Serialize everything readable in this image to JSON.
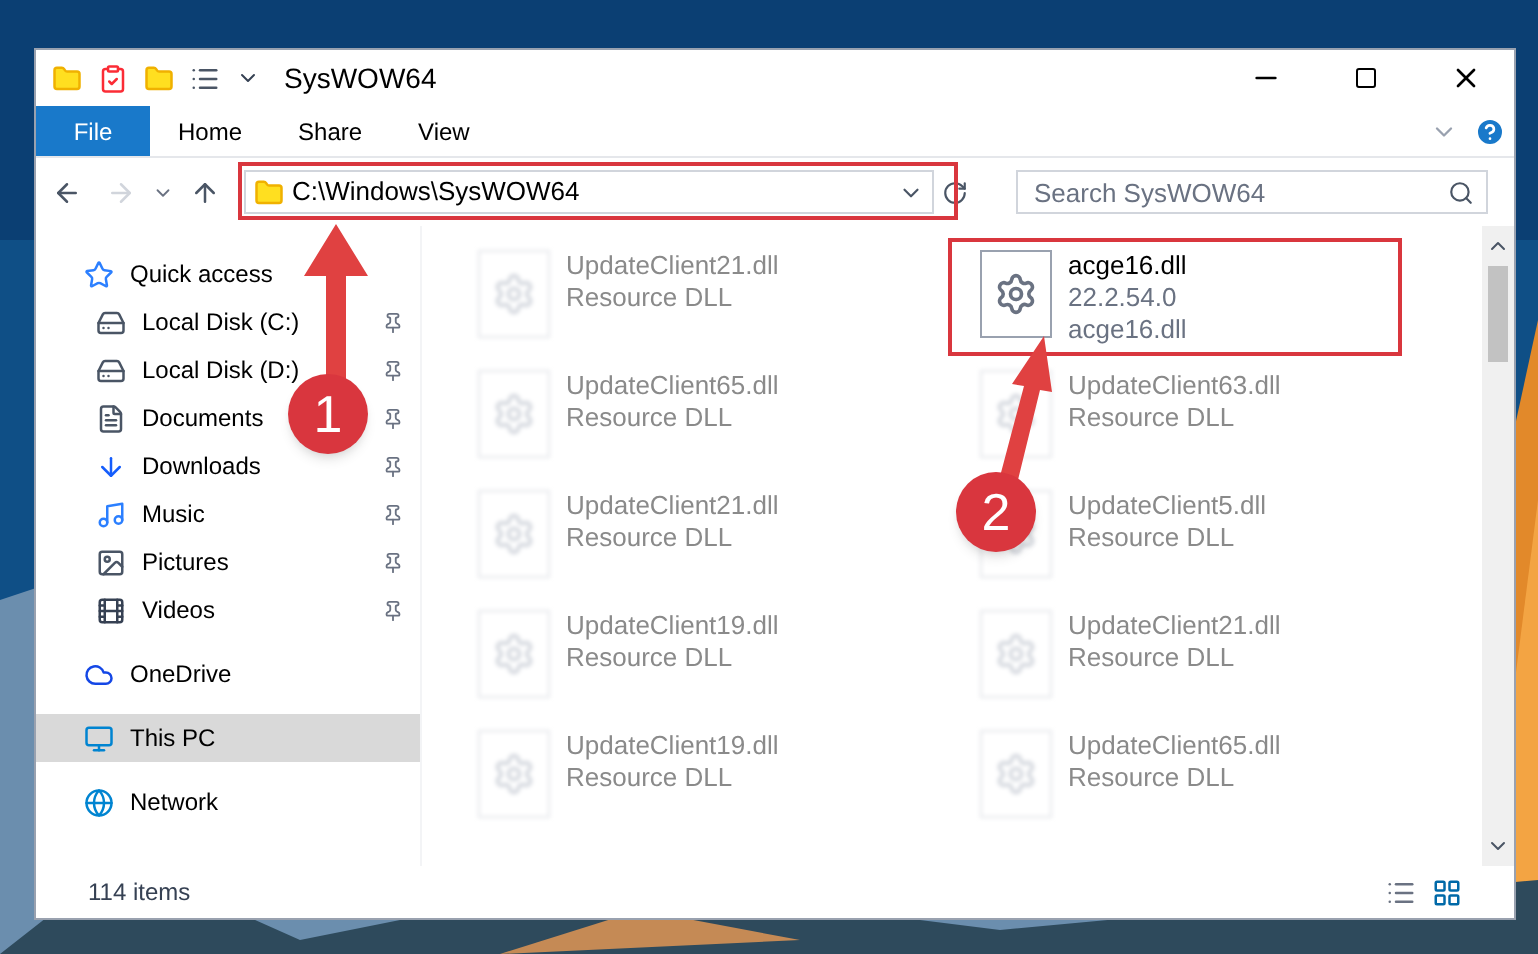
{
  "window": {
    "title": "SysWOW64"
  },
  "ribbon_tabs": [
    {
      "label": "File",
      "selected": true
    },
    {
      "label": "Home",
      "selected": false
    },
    {
      "label": "Share",
      "selected": false
    },
    {
      "label": "View",
      "selected": false
    }
  ],
  "address": {
    "path": "C:\\Windows\\SysWOW64"
  },
  "search": {
    "placeholder": "Search SysWOW64"
  },
  "sidebar": {
    "items": [
      {
        "label": "Quick access",
        "selected": false,
        "children": [
          {
            "label": "Local Disk (C:)",
            "pinned": true
          },
          {
            "label": "Local Disk (D:)",
            "pinned": true
          },
          {
            "label": "Documents",
            "pinned": true
          },
          {
            "label": "Downloads",
            "pinned": true
          },
          {
            "label": "Music",
            "pinned": true
          },
          {
            "label": "Pictures",
            "pinned": true
          },
          {
            "label": "Videos",
            "pinned": true
          }
        ]
      },
      {
        "label": "OneDrive",
        "selected": false
      },
      {
        "label": "This PC",
        "selected": true
      },
      {
        "label": "Network",
        "selected": false
      }
    ]
  },
  "files": [
    {
      "kind": "blurred",
      "name": "UpdateClient21.dll",
      "lines": [
        "Resource DLL"
      ]
    },
    {
      "kind": "clear",
      "name": "acge16.dll",
      "lines": [
        "22.2.54.0",
        "acge16.dll"
      ]
    },
    {
      "kind": "blurred",
      "name": "UpdateClient65.dll",
      "lines": [
        "Resource DLL"
      ]
    },
    {
      "kind": "blurred",
      "name": "UpdateClient63.dll",
      "lines": [
        "Resource DLL"
      ]
    },
    {
      "kind": "blurred",
      "name": "UpdateClient21.dll",
      "lines": [
        "Resource DLL"
      ]
    },
    {
      "kind": "blurred",
      "name": "UpdateClient5.dll",
      "lines": [
        "Resource DLL"
      ]
    },
    {
      "kind": "blurred",
      "name": "UpdateClient19.dll",
      "lines": [
        "Resource DLL"
      ]
    },
    {
      "kind": "blurred",
      "name": "UpdateClient21.dll",
      "lines": [
        "Resource DLL"
      ]
    },
    {
      "kind": "blurred",
      "name": "UpdateClient19.dll",
      "lines": [
        "Resource DLL"
      ]
    },
    {
      "kind": "blurred",
      "name": "UpdateClient65.dll",
      "lines": [
        "Resource DLL"
      ]
    }
  ],
  "status_bar": {
    "item_count": "114 items"
  },
  "annotations": [
    {
      "label": "1"
    },
    {
      "label": "2"
    }
  ]
}
